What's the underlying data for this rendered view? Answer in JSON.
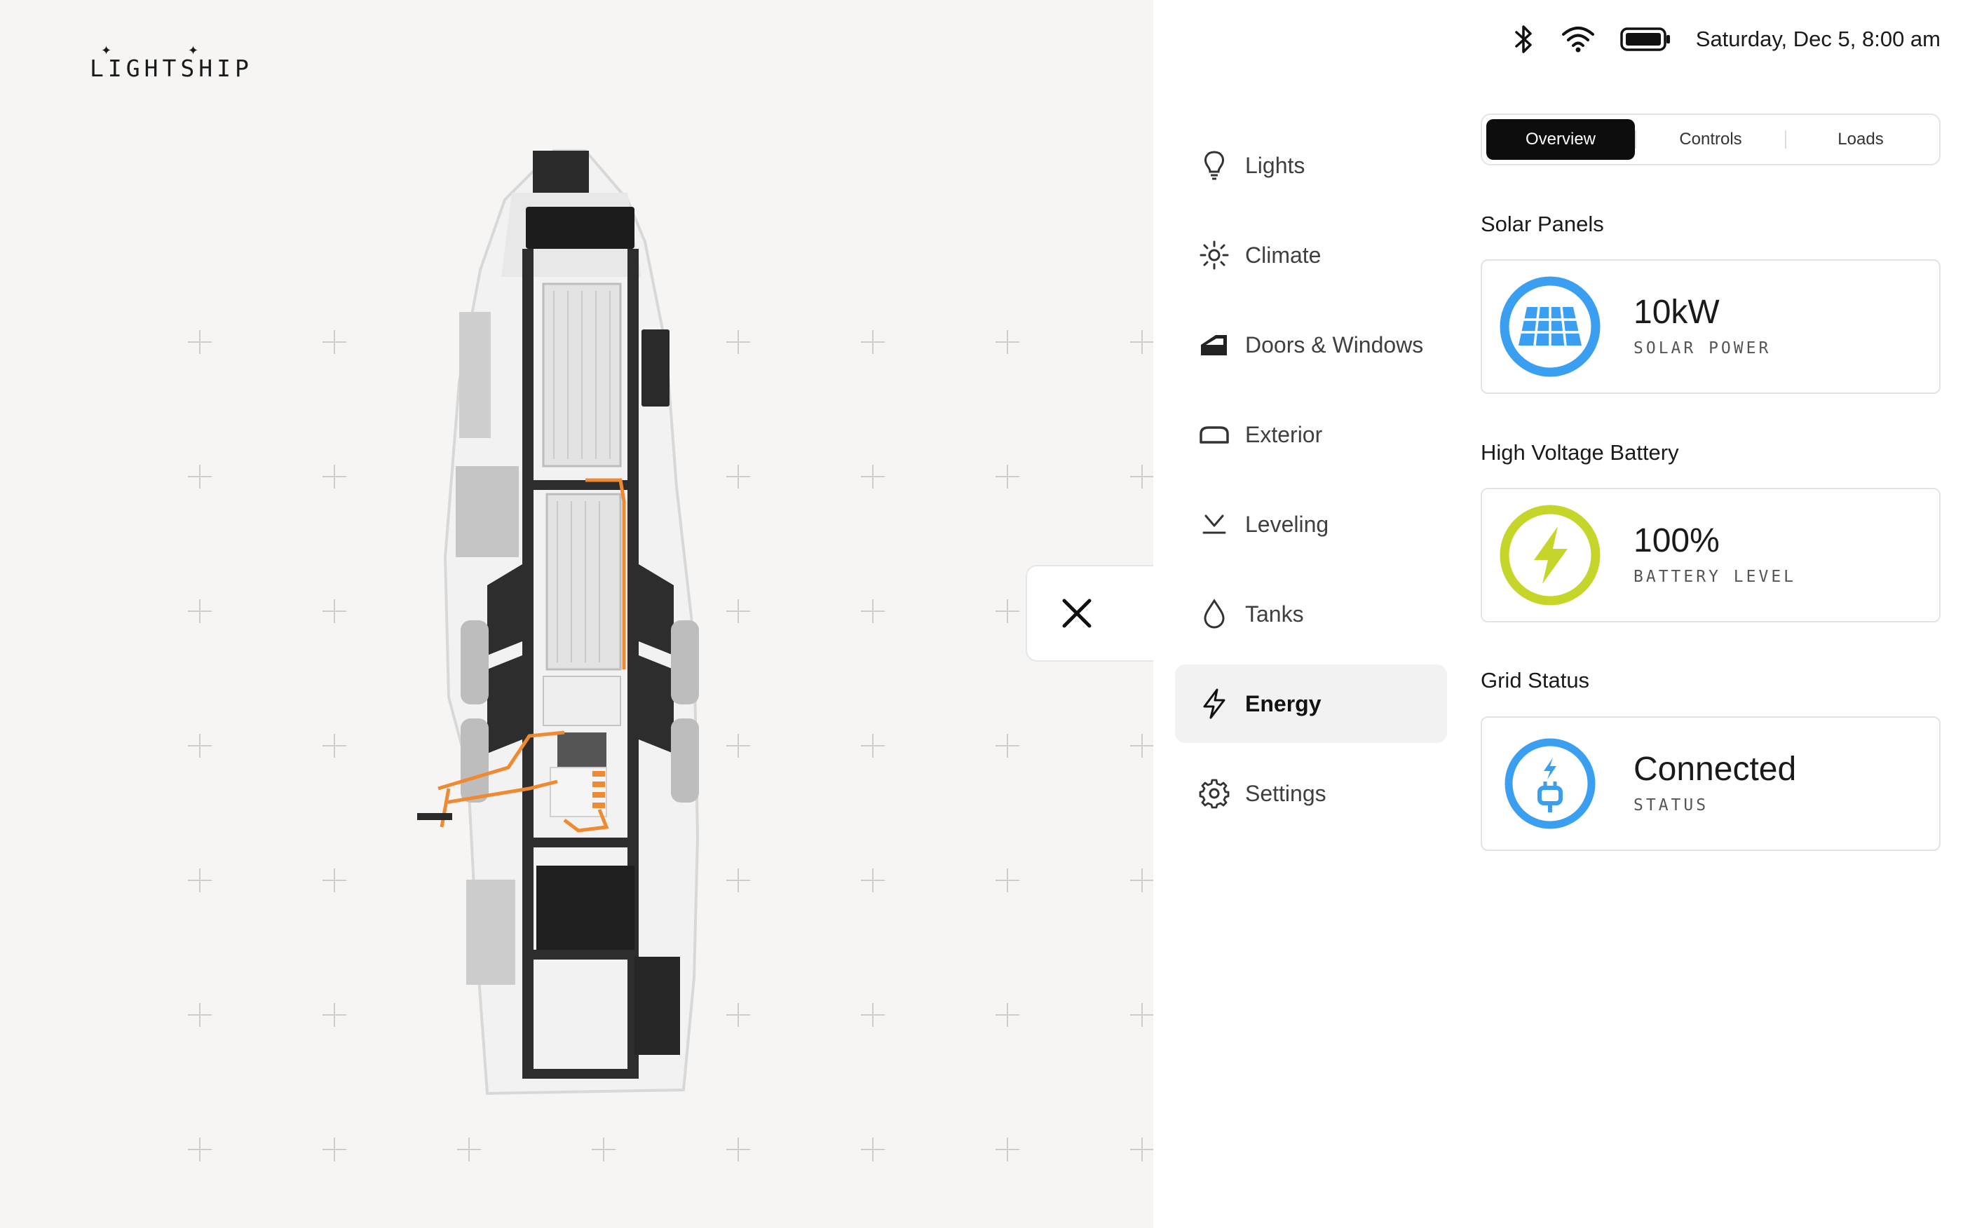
{
  "brand": {
    "name": "LIGHTSHIP"
  },
  "status_bar": {
    "datetime": "Saturday, Dec 5, 8:00 am",
    "icons": [
      "bluetooth-icon",
      "wifi-icon",
      "battery-icon"
    ]
  },
  "nav": {
    "items": [
      {
        "label": "Lights",
        "icon": "lightbulb-icon",
        "active": false
      },
      {
        "label": "Climate",
        "icon": "climate-icon",
        "active": false
      },
      {
        "label": "Doors & Windows",
        "icon": "door-icon",
        "active": false
      },
      {
        "label": "Exterior",
        "icon": "exterior-icon",
        "active": false
      },
      {
        "label": "Leveling",
        "icon": "leveling-icon",
        "active": false
      },
      {
        "label": "Tanks",
        "icon": "droplet-icon",
        "active": false
      },
      {
        "label": "Energy",
        "icon": "lightning-icon",
        "active": true
      },
      {
        "label": "Settings",
        "icon": "gear-icon",
        "active": false
      }
    ]
  },
  "tabs": [
    {
      "label": "Overview",
      "active": true
    },
    {
      "label": "Controls",
      "active": false
    },
    {
      "label": "Loads",
      "active": false
    }
  ],
  "energy": {
    "solar": {
      "title": "Solar Panels",
      "value": "10kW",
      "caption": "SOLAR POWER",
      "color": "#3a9ff0",
      "icon": "solar-panel-icon"
    },
    "battery": {
      "title": "High Voltage Battery",
      "value": "100%",
      "caption": "BATTERY LEVEL",
      "color": "#c5d52a",
      "icon": "lightning-icon",
      "level": 1.0
    },
    "grid": {
      "title": "Grid Status",
      "value": "Connected",
      "caption": "STATUS",
      "color": "#3a9ff0",
      "icon": "plug-icon"
    }
  },
  "colors": {
    "accent_orange": "#f08a32",
    "active_tab": "#0d0d0d",
    "nav_active_bg": "#f2f2f2"
  }
}
